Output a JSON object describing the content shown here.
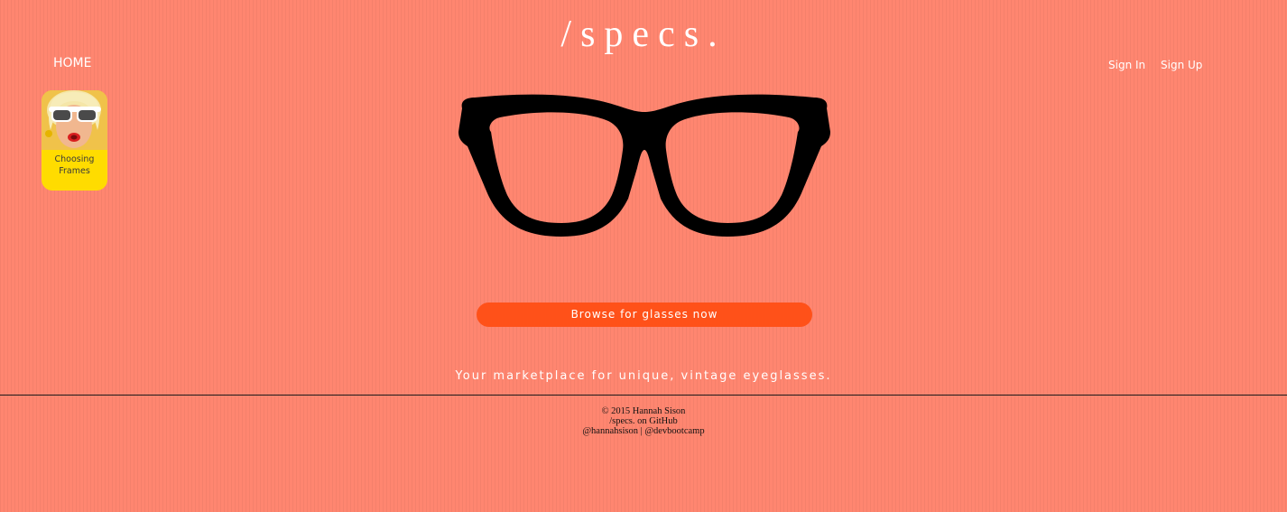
{
  "header": {
    "logo": "/specs."
  },
  "nav": {
    "home": "HOME",
    "sign_in": "Sign In",
    "sign_up": "Sign Up"
  },
  "feature_card": {
    "label": "Choosing\nFrames",
    "background_color": "#ffdc00"
  },
  "hero": {
    "image_icon": "eyeglasses-silhouette",
    "button_label": "Browse for glasses now",
    "tagline": "Your marketplace for unique, vintage eyeglasses."
  },
  "footer": {
    "copyright": "© 2015 Hannah Sison",
    "github_link": "/specs. on GitHub",
    "handle_author": "@hannahsison",
    "separator": "|",
    "handle_bootcamp": "@devbootcamp"
  },
  "colors": {
    "background": "#ff8670",
    "button": "#ff5119",
    "text": "#ffffff"
  }
}
